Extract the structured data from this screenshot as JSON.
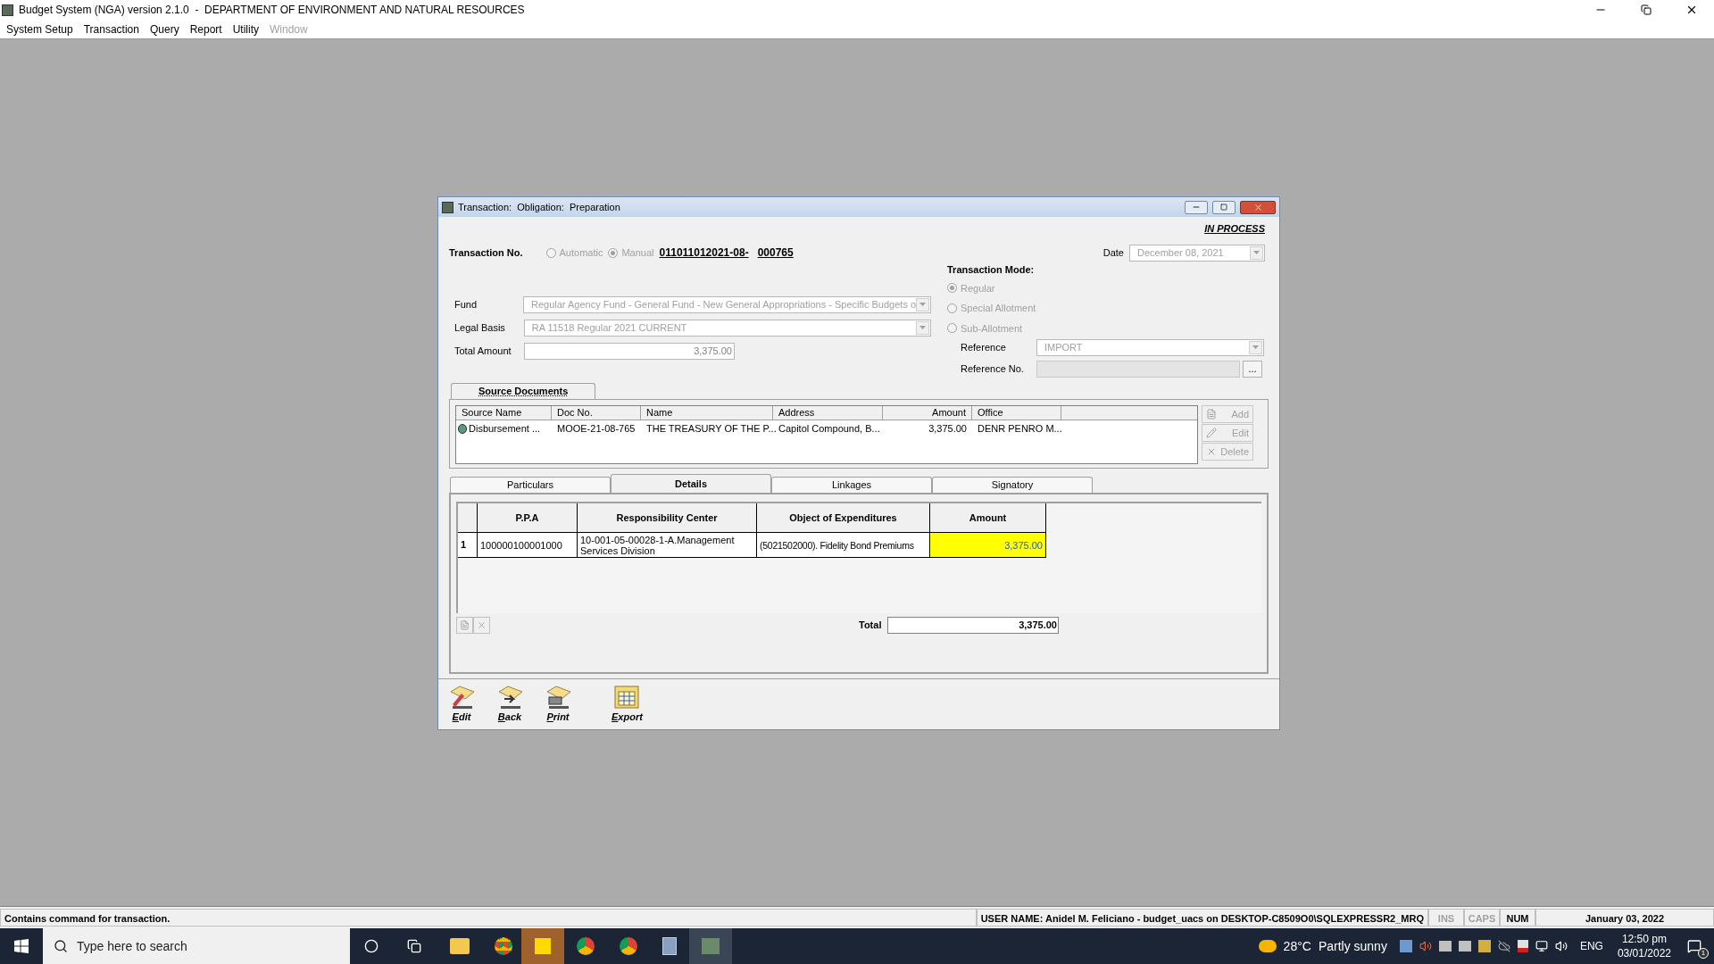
{
  "app_title": "Budget System (NGA) version 2.1.0  -  DEPARTMENT OF ENVIRONMENT AND NATURAL RESOURCES",
  "menu": [
    {
      "label": "System Setup",
      "disabled": false
    },
    {
      "label": "Transaction",
      "disabled": false
    },
    {
      "label": "Query",
      "disabled": false
    },
    {
      "label": "Report",
      "disabled": false
    },
    {
      "label": "Utility",
      "disabled": false
    },
    {
      "label": "Window",
      "disabled": true
    }
  ],
  "dialog": {
    "title": "Transaction:  Obligation:  Preparation",
    "status": "IN PROCESS",
    "transaction_no": {
      "label": "Transaction No.",
      "options": [
        {
          "label": "Automatic",
          "selected": false
        },
        {
          "label": "Manual",
          "selected": true
        }
      ],
      "number_prefix": "011011012021-08-",
      "number_suffix": "000765"
    },
    "date": {
      "label": "Date",
      "value": "December  08, 2021"
    },
    "fields": [
      {
        "label": "Fund",
        "value": "Regular Agency Fund - General Fund - New General Appropriations - Specific Budgets o",
        "kind": "dropdown"
      },
      {
        "label": "Legal Basis",
        "value": "RA 11518 Regular 2021 CURRENT",
        "kind": "dropdown"
      },
      {
        "label": "Total Amount",
        "value": "3,375.00",
        "kind": "amount"
      }
    ],
    "transaction_mode": {
      "label": "Transaction Mode:",
      "options": [
        {
          "label": "Regular",
          "selected": true
        },
        {
          "label": "Special Allotment",
          "selected": false
        },
        {
          "label": "Sub-Allotment",
          "selected": false
        }
      ]
    },
    "reference": {
      "label": "Reference",
      "value": "IMPORT"
    },
    "reference_no": {
      "label": "Reference No.",
      "button": "..."
    },
    "source_documents": {
      "tab": "Source Documents",
      "columns": [
        "Source Name",
        "Doc No.",
        "Name",
        "Address",
        "Amount",
        "Office"
      ],
      "rows": [
        [
          "Disbursement ...",
          "MOOE-21-08-765",
          "THE TREASURY OF THE P...",
          "Capitol Compound, B...",
          "3,375.00",
          "DENR PENRO M..."
        ]
      ],
      "buttons": [
        {
          "label": "Add",
          "kind": "add"
        },
        {
          "label": "Edit",
          "kind": "edit"
        },
        {
          "label": "Delete",
          "kind": "delete"
        }
      ]
    },
    "tabs": [
      {
        "label": "Particulars",
        "selected": false
      },
      {
        "label": "Details",
        "selected": true
      },
      {
        "label": "Linkages",
        "selected": false
      },
      {
        "label": "Signatory",
        "selected": false
      }
    ],
    "details": {
      "columns": [
        "P.P.A",
        "Responsibility Center",
        "Object of Expenditures",
        "Amount"
      ],
      "rows": [
        {
          "index": "1",
          "cells": [
            "100000100001000",
            "10-001-05-00028-1-A.Management Services Division",
            "(5021502000).  Fidelity Bond Premiums",
            "3,375.00"
          ]
        }
      ],
      "total_label": "Total",
      "total": "3,375.00"
    },
    "toolbar": [
      {
        "label": "Edit",
        "kind": "edit"
      },
      {
        "label": "Back",
        "kind": "back"
      },
      {
        "label": "Print",
        "kind": "print"
      },
      {
        "label": "Export",
        "kind": "export"
      }
    ]
  },
  "status_bar": {
    "message": "Contains command for transaction.",
    "user": "USER NAME: Anidel M. Feliciano - budget_uacs on DESKTOP-C8509O0\\SQLEXPRESSR2_MRQ",
    "indicators": [
      {
        "label": "INS",
        "on": false
      },
      {
        "label": "CAPS",
        "on": false
      },
      {
        "label": "NUM",
        "on": true
      }
    ],
    "date": "January 03, 2022"
  },
  "taskbar": {
    "search_placeholder": "Type here to search",
    "temperature": "28°C",
    "weather": "Partly sunny",
    "language": "ENG",
    "time": "12:50 pm",
    "date": "03/01/2022",
    "notifications": "1"
  }
}
